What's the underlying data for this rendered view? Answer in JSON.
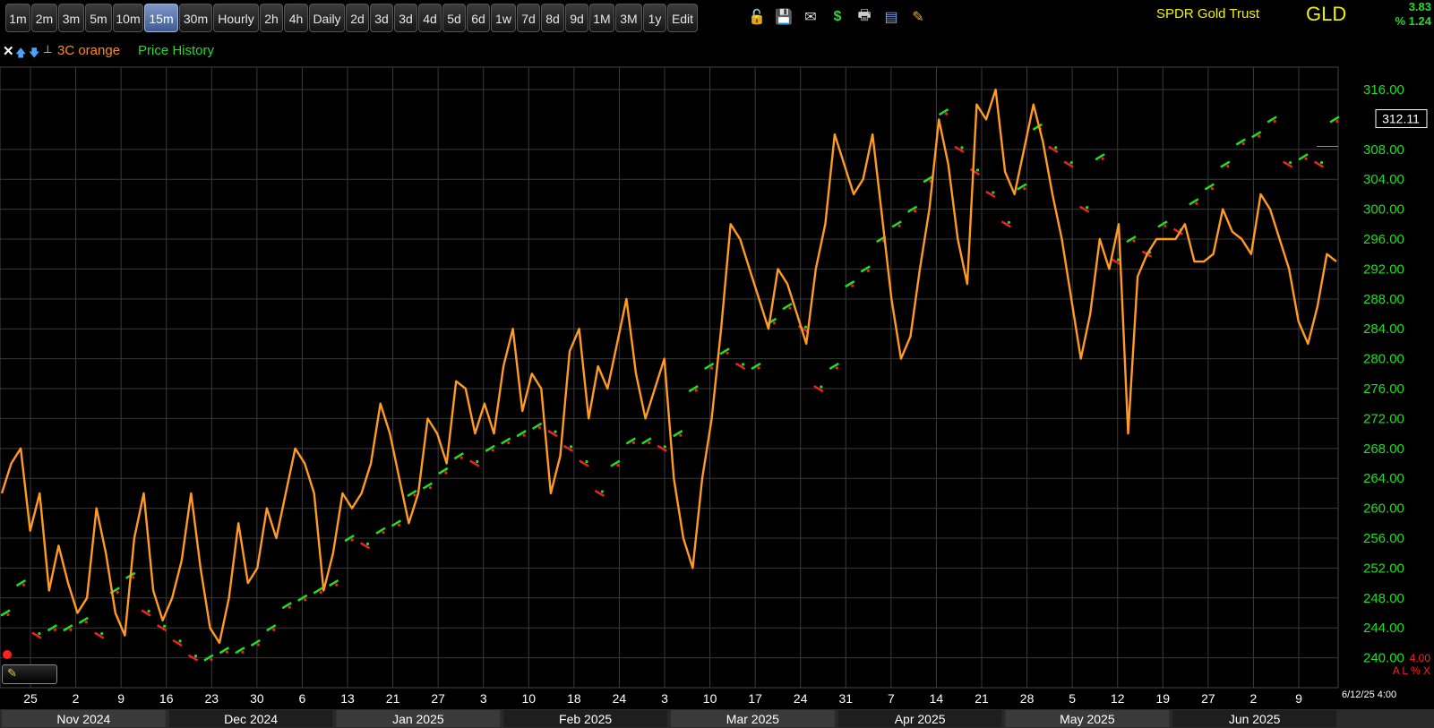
{
  "toolbar": {
    "timeframes": [
      "1m",
      "2m",
      "3m",
      "5m",
      "10m",
      "15m",
      "30m",
      "Hourly",
      "2h",
      "4h",
      "Daily",
      "2d",
      "3d",
      "3d",
      "4d",
      "5d",
      "6d",
      "1w",
      "7d",
      "8d",
      "9d",
      "1M",
      "3M",
      "1y",
      "Edit"
    ],
    "active_timeframe": "15m",
    "tools": [
      {
        "name": "lock-icon",
        "glyph": "🔓"
      },
      {
        "name": "save-icon",
        "glyph": "💾"
      },
      {
        "name": "email-icon",
        "glyph": "✉"
      },
      {
        "name": "dollar-icon",
        "glyph": "$"
      },
      {
        "name": "print-icon",
        "glyph": "🖶"
      },
      {
        "name": "card-icon",
        "glyph": "▤"
      },
      {
        "name": "pencil-icon",
        "glyph": "✎"
      }
    ]
  },
  "header": {
    "instrument_name": "SPDR Gold Trust",
    "symbol": "GLD",
    "change": "3.83",
    "change_pct": "% 1.24"
  },
  "legend": {
    "close_glyph": "✕",
    "up_glyph": "🡅",
    "down_glyph": "🡇",
    "pin_glyph": "⊥",
    "indicator_label": "3C orange",
    "price_label": "Price History"
  },
  "footer": {
    "datetime": "6/12/25 4:00",
    "sub_scale_value": "4.00",
    "sub_controls": "A L % X"
  },
  "colors": {
    "indicator": "#ff9a22",
    "up": "#22dd22",
    "down": "#ee2222",
    "axis_text": "#22dd22",
    "header_text": "#f2f200",
    "grid": "#3a3a3a"
  },
  "chart_data": {
    "type": "line",
    "last_price": "312.11",
    "y_ticks": [
      240,
      244,
      248,
      252,
      256,
      260,
      264,
      268,
      272,
      276,
      280,
      284,
      288,
      292,
      296,
      300,
      304,
      308,
      316
    ],
    "ylim": [
      236,
      319
    ],
    "x_day_labels": [
      "25",
      "2",
      "9",
      "16",
      "23",
      "30",
      "6",
      "13",
      "21",
      "27",
      "3",
      "10",
      "18",
      "24",
      "3",
      "10",
      "17",
      "24",
      "31",
      "7",
      "14",
      "21",
      "28",
      "5",
      "12",
      "19",
      "27",
      "2",
      "9"
    ],
    "x_month_labels": [
      "Nov 2024",
      "Dec 2024",
      "Jan 2025",
      "Feb 2025",
      "Mar 2025",
      "Apr 2025",
      "May 2025",
      "Jun 2025"
    ],
    "series": [
      {
        "name": "Price History",
        "kind": "price",
        "values": [
          246,
          250,
          243,
          244,
          244,
          245,
          243,
          249,
          251,
          246,
          244,
          242,
          240,
          240,
          241,
          241,
          242,
          244,
          247,
          248,
          249,
          250,
          256,
          255,
          257,
          258,
          262,
          263,
          265,
          267,
          266,
          268,
          269,
          270,
          271,
          270,
          268,
          266,
          262,
          266,
          269,
          269,
          268,
          270,
          276,
          279,
          281,
          279,
          279,
          285,
          287,
          284,
          276,
          279,
          290,
          292,
          296,
          298,
          300,
          304,
          313,
          308,
          305,
          302,
          298,
          303,
          311,
          308,
          306,
          300,
          307,
          293,
          296,
          294,
          298,
          297,
          301,
          303,
          306,
          309,
          310,
          312,
          306,
          307,
          306,
          312
        ]
      },
      {
        "name": "3C orange",
        "kind": "indicator",
        "values": [
          262,
          266,
          268,
          257,
          262,
          249,
          255,
          250,
          246,
          248,
          260,
          254,
          246,
          243,
          256,
          262,
          249,
          245,
          248,
          253,
          262,
          252,
          244,
          242,
          248,
          258,
          250,
          252,
          260,
          256,
          262,
          268,
          266,
          262,
          249,
          254,
          262,
          260,
          262,
          266,
          274,
          270,
          264,
          258,
          262,
          272,
          270,
          266,
          277,
          276,
          270,
          274,
          270,
          279,
          284,
          273,
          278,
          276,
          262,
          267,
          281,
          284,
          272,
          279,
          276,
          282,
          288,
          278,
          272,
          276,
          280,
          264,
          256,
          252,
          264,
          272,
          284,
          298,
          296,
          292,
          288,
          284,
          292,
          290,
          286,
          282,
          292,
          298,
          310,
          306,
          302,
          304,
          310,
          299,
          288,
          280,
          283,
          292,
          300,
          312,
          306,
          296,
          290,
          314,
          312,
          316,
          305,
          302,
          308,
          314,
          309,
          302,
          296,
          288,
          280,
          286,
          296,
          292,
          298,
          270,
          291,
          294,
          296,
          296,
          296,
          298,
          293,
          293,
          294,
          300,
          297,
          296,
          294,
          302,
          300,
          296,
          292,
          285,
          282,
          287,
          294,
          293
        ]
      }
    ]
  }
}
